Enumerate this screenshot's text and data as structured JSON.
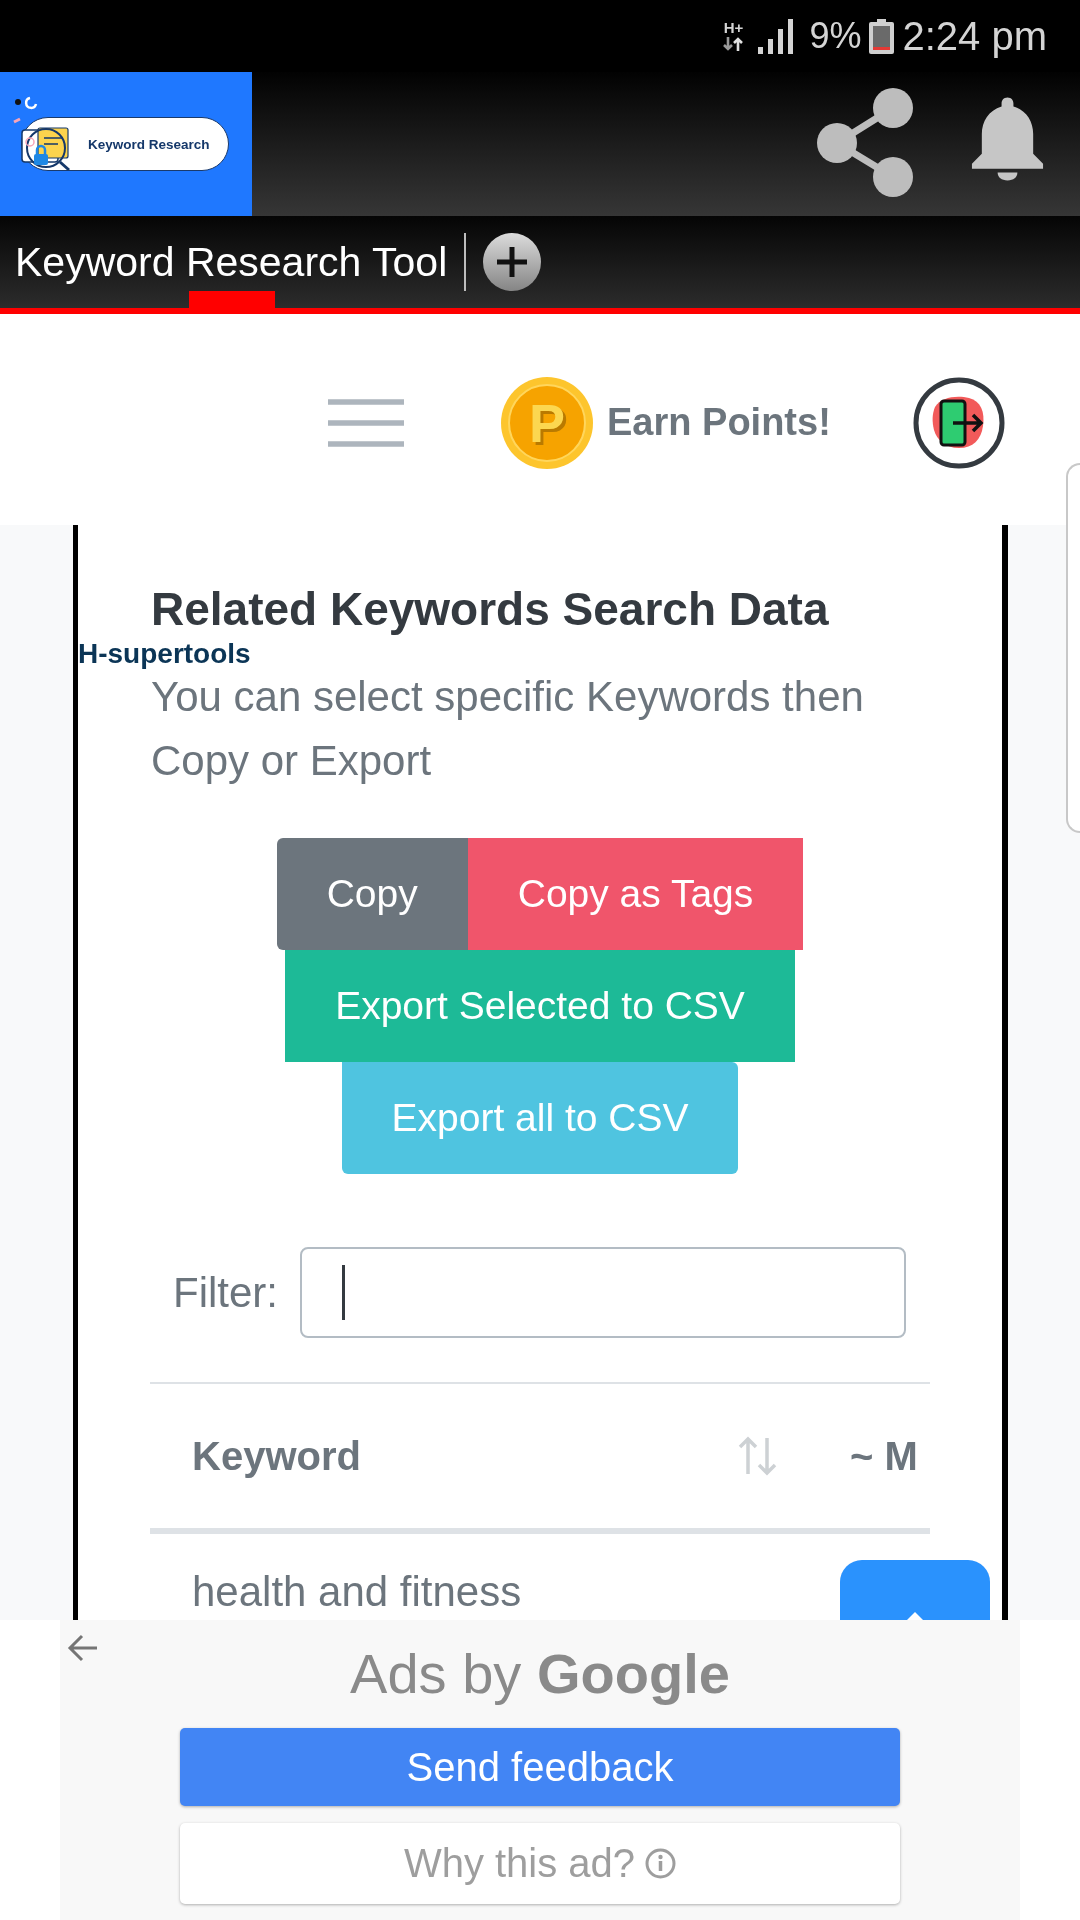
{
  "status_bar": {
    "network": "H+",
    "battery": "9%",
    "time": "2:24 pm"
  },
  "app_header": {
    "logo_text": "Keyword Research"
  },
  "tabs": [
    {
      "label": "Keyword Research Tool",
      "selected": true
    }
  ],
  "nav": {
    "coin_letter": "P",
    "earn_points": "Earn Points!"
  },
  "card": {
    "brand": "H-supertools",
    "title": "Related Keywords Search Data",
    "description": "You can select specific Keywords then Copy or Export",
    "buttons": [
      {
        "label": "Copy",
        "kind": "secondary"
      },
      {
        "label": "Copy as Tags",
        "kind": "danger"
      },
      {
        "label": "Export Selected to CSV",
        "kind": "success"
      },
      {
        "label": "Export all to CSV",
        "kind": "info"
      }
    ],
    "filter": {
      "label": "Filter:",
      "focused": true
    },
    "table": {
      "columns": [
        {
          "label": "Keyword",
          "sortable": true
        },
        {
          "label": "~ M",
          "sortable": false
        }
      ],
      "rows": [
        {
          "cells": [
            "health and fitness"
          ]
        }
      ]
    }
  },
  "ad_panel": {
    "label": "Ads by",
    "brand": "Google",
    "buttons": [
      {
        "label": "Send feedback",
        "kind": "primary"
      },
      {
        "label": "Why this ad?",
        "kind": "secondary"
      }
    ]
  }
}
